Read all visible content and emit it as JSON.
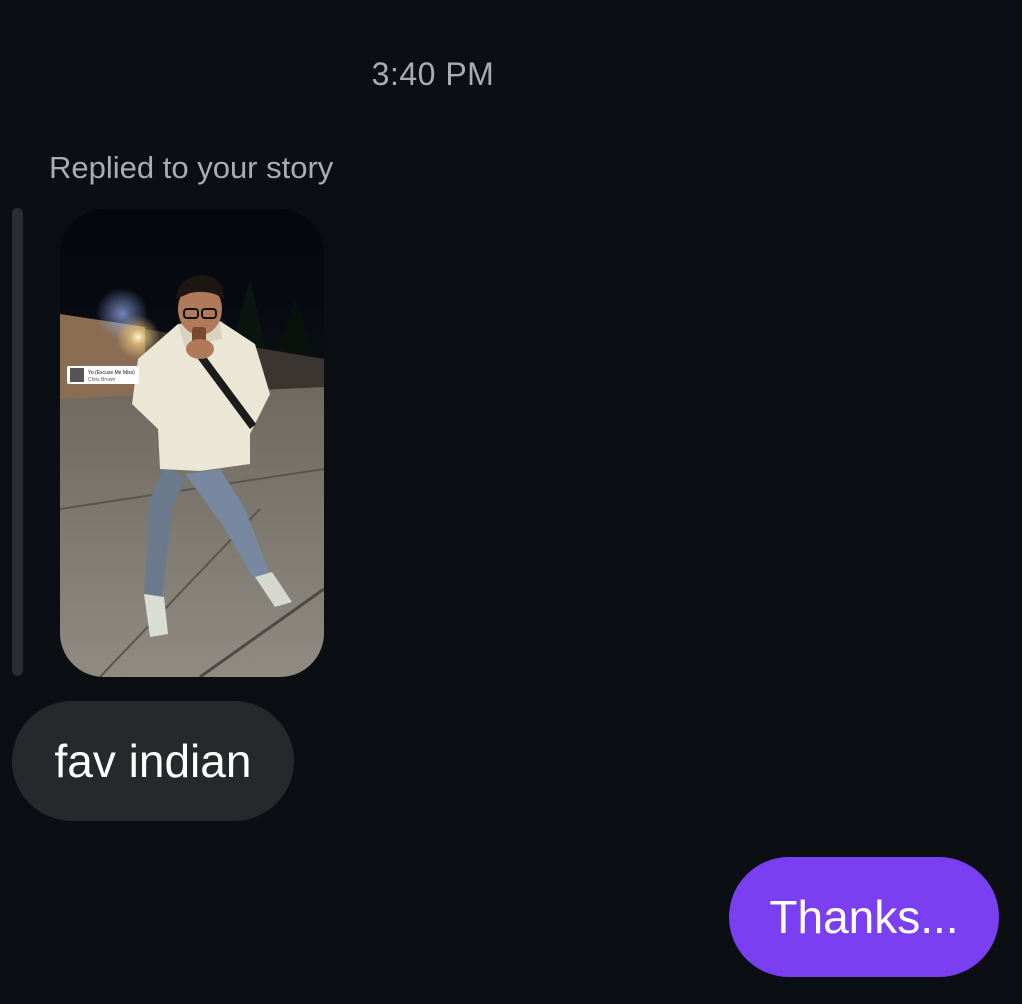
{
  "conversation": {
    "timestamp": "3:40 PM",
    "reply_context": "Replied to your story",
    "story": {
      "music_sticker": {
        "title": "Yo (Excuse Me Miss)",
        "artist": "Chris Brown"
      }
    },
    "messages": [
      {
        "direction": "incoming",
        "text": "fav indian"
      },
      {
        "direction": "outgoing",
        "text": "Thanks..."
      }
    ]
  },
  "colors": {
    "background": "#0b0f14",
    "incoming_bubble": "#26282c",
    "outgoing_bubble": "#7b3ff2",
    "secondary_text": "#a9adb3"
  }
}
